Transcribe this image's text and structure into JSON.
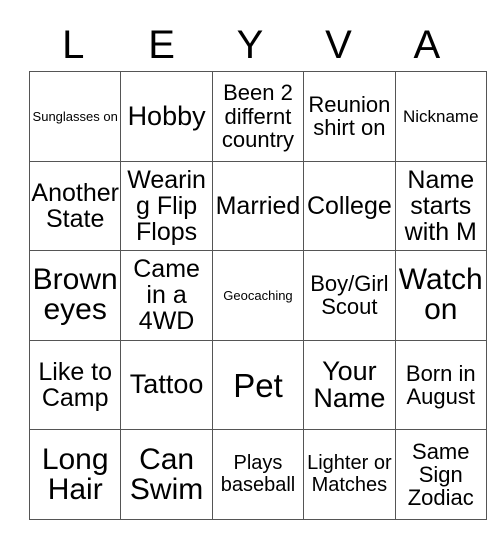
{
  "card": {
    "header_letters": [
      "L",
      "E",
      "Y",
      "V",
      "A"
    ],
    "colors": {
      "text": "#000000",
      "grid_line": "#555555",
      "background": "#ffffff"
    },
    "rows": [
      [
        {
          "label": "Sunglasses on",
          "size": "fs-xs"
        },
        {
          "label": "Hobby",
          "size": "fs-2xl"
        },
        {
          "label": "Been 2 differnt country",
          "size": "fs-lg"
        },
        {
          "label": "Reunion shirt on",
          "size": "fs-lg"
        },
        {
          "label": "Nickname",
          "size": "fs-sm"
        }
      ],
      [
        {
          "label": "Another State",
          "size": "fs-xl"
        },
        {
          "label": "Wearing Flip Flops",
          "size": "fs-xl"
        },
        {
          "label": "Married",
          "size": "fs-xl"
        },
        {
          "label": "College",
          "size": "fs-xl"
        },
        {
          "label": "Name starts with M",
          "size": "fs-xl"
        }
      ],
      [
        {
          "label": "Brown eyes",
          "size": "fs-3xl"
        },
        {
          "label": "Came in a 4WD",
          "size": "fs-xl"
        },
        {
          "label": "Geocaching",
          "size": "fs-xs"
        },
        {
          "label": "Boy/Girl Scout",
          "size": "fs-lg"
        },
        {
          "label": "Watch on",
          "size": "fs-3xl"
        }
      ],
      [
        {
          "label": "Like to Camp",
          "size": "fs-xl"
        },
        {
          "label": "Tattoo",
          "size": "fs-2xl"
        },
        {
          "label": "Pet",
          "size": "fs-4xl"
        },
        {
          "label": "Your Name",
          "size": "fs-2xl"
        },
        {
          "label": "Born in August",
          "size": "fs-lg"
        }
      ],
      [
        {
          "label": "Long Hair",
          "size": "fs-3xl"
        },
        {
          "label": "Can Swim",
          "size": "fs-3xl"
        },
        {
          "label": "Plays baseball",
          "size": "fs-md"
        },
        {
          "label": "Lighter or Matches",
          "size": "fs-md"
        },
        {
          "label": "Same Sign Zodiac",
          "size": "fs-lg"
        }
      ]
    ]
  }
}
